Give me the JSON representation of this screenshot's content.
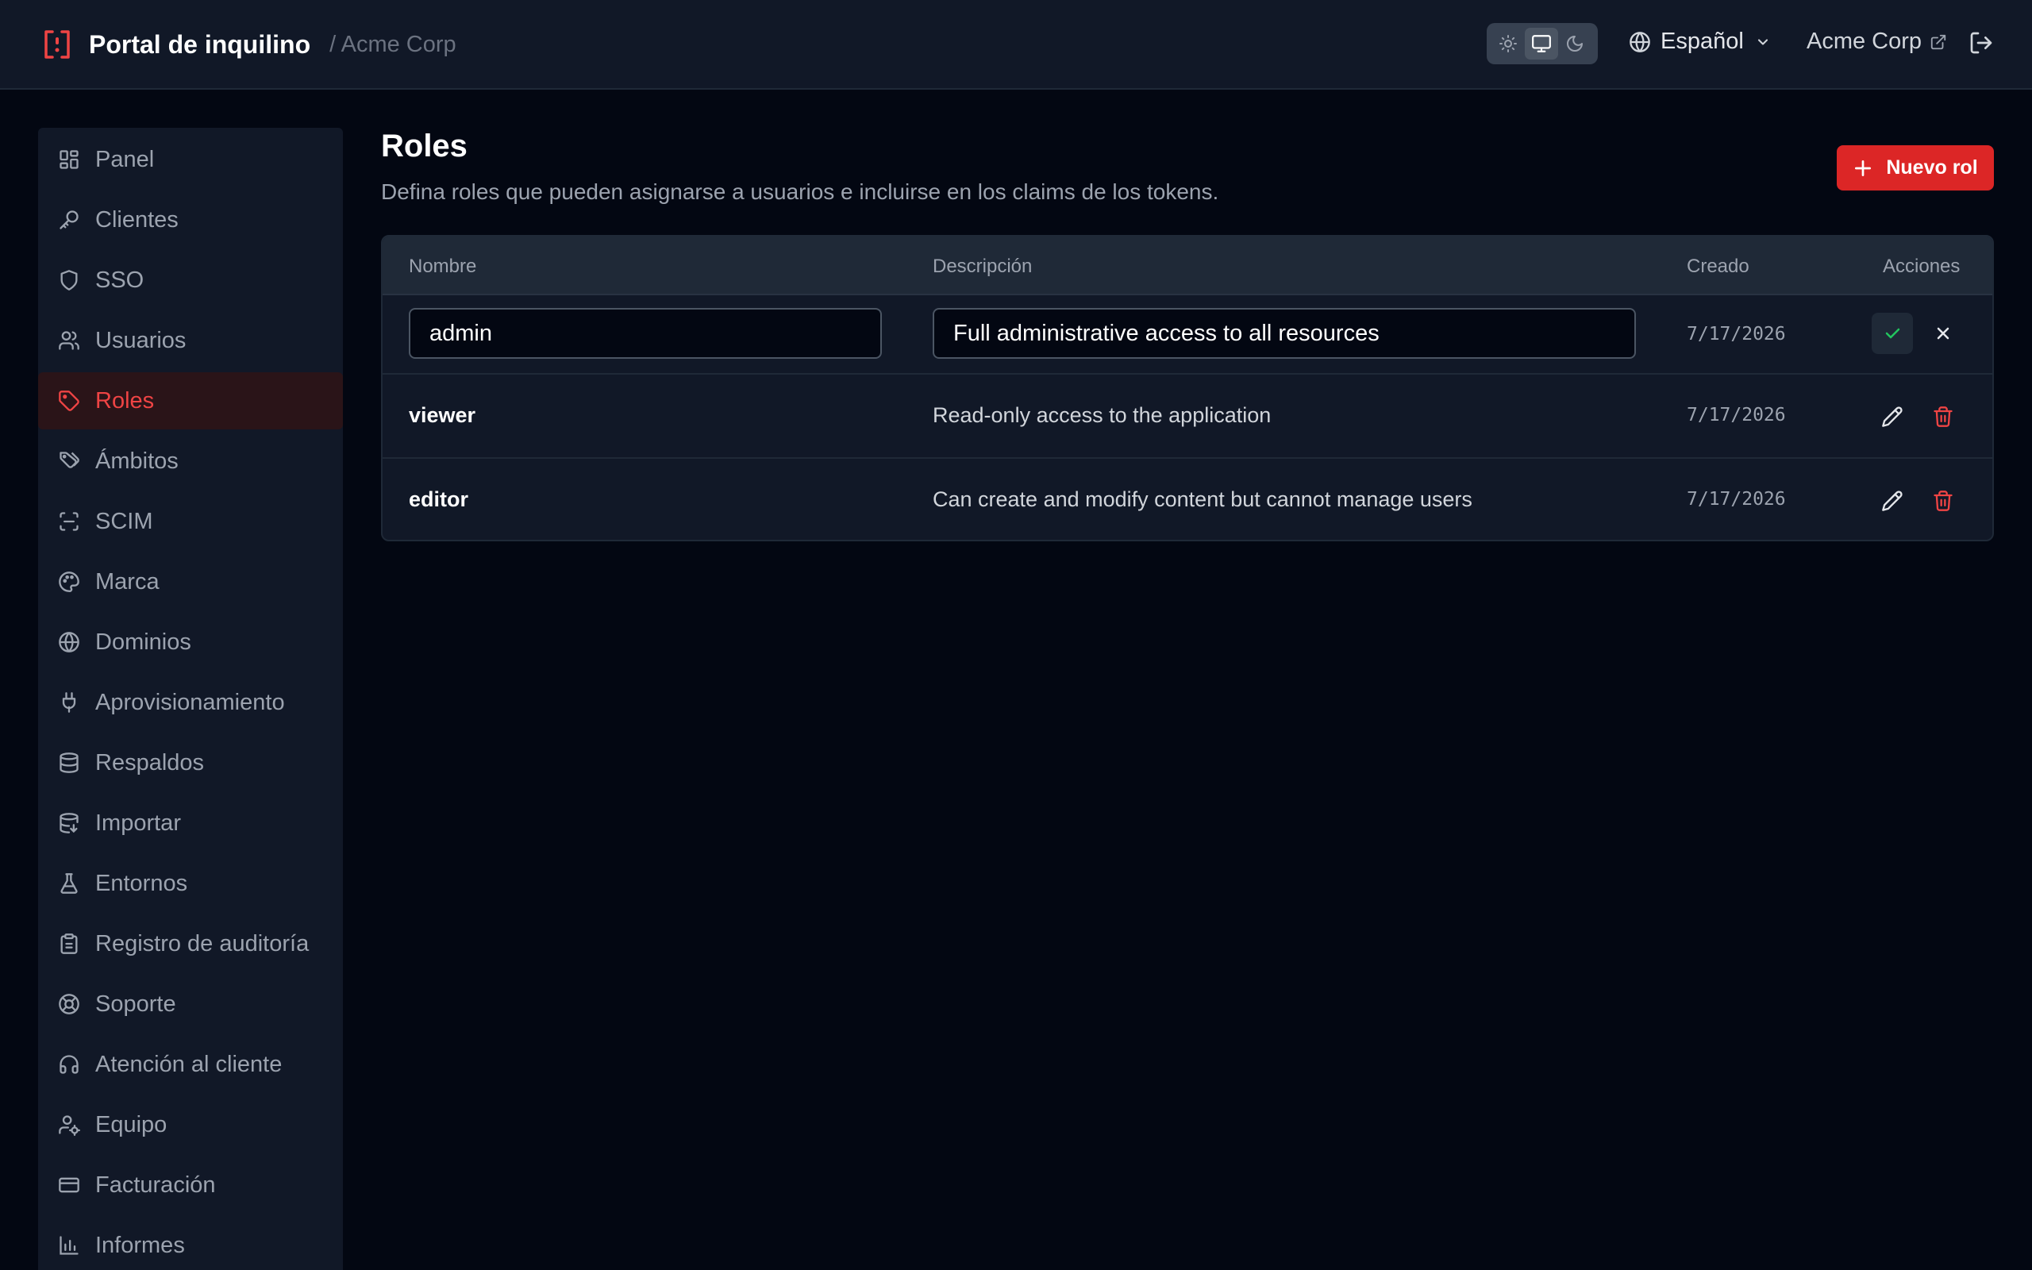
{
  "header": {
    "title": "Portal de inquilino",
    "breadcrumb": "/ Acme Corp",
    "language": "Español",
    "org_link": "Acme Corp",
    "theme_options": [
      "light",
      "system",
      "dark"
    ],
    "theme_selected": "system"
  },
  "sidebar": {
    "items": [
      {
        "label": "Panel",
        "icon": "dashboard-icon"
      },
      {
        "label": "Clientes",
        "icon": "key-icon"
      },
      {
        "label": "SSO",
        "icon": "shield-icon"
      },
      {
        "label": "Usuarios",
        "icon": "users-icon"
      },
      {
        "label": "Roles",
        "icon": "tag-icon",
        "active": true
      },
      {
        "label": "Ámbitos",
        "icon": "tags-icon"
      },
      {
        "label": "SCIM",
        "icon": "scan-icon"
      },
      {
        "label": "Marca",
        "icon": "palette-icon"
      },
      {
        "label": "Dominios",
        "icon": "globe-icon"
      },
      {
        "label": "Aprovisionamiento",
        "icon": "plug-icon"
      },
      {
        "label": "Respaldos",
        "icon": "database-icon"
      },
      {
        "label": "Importar",
        "icon": "database-import-icon"
      },
      {
        "label": "Entornos",
        "icon": "flask-icon"
      },
      {
        "label": "Registro de auditoría",
        "icon": "clipboard-icon"
      },
      {
        "label": "Soporte",
        "icon": "lifebuoy-icon"
      },
      {
        "label": "Atención al cliente",
        "icon": "headset-icon"
      },
      {
        "label": "Equipo",
        "icon": "user-gear-icon"
      },
      {
        "label": "Facturación",
        "icon": "credit-card-icon"
      },
      {
        "label": "Informes",
        "icon": "bar-chart-icon"
      }
    ]
  },
  "main": {
    "title": "Roles",
    "subtitle": "Defina roles que pueden asignarse a usuarios e incluirse en los claims de los tokens.",
    "new_button": "Nuevo rol",
    "table": {
      "columns": [
        "Nombre",
        "Descripción",
        "Creado",
        "Acciones"
      ],
      "editing_row": {
        "name": "admin",
        "description": "Full administrative access to all resources",
        "created": "7/17/2026"
      },
      "rows": [
        {
          "name": "viewer",
          "description": "Read-only access to the application",
          "created": "7/17/2026"
        },
        {
          "name": "editor",
          "description": "Can create and modify content but cannot manage users",
          "created": "7/17/2026"
        }
      ]
    }
  },
  "colors": {
    "accent": "#dc2626",
    "success": "#22c55e",
    "background": "#030712",
    "surface": "#111827"
  }
}
